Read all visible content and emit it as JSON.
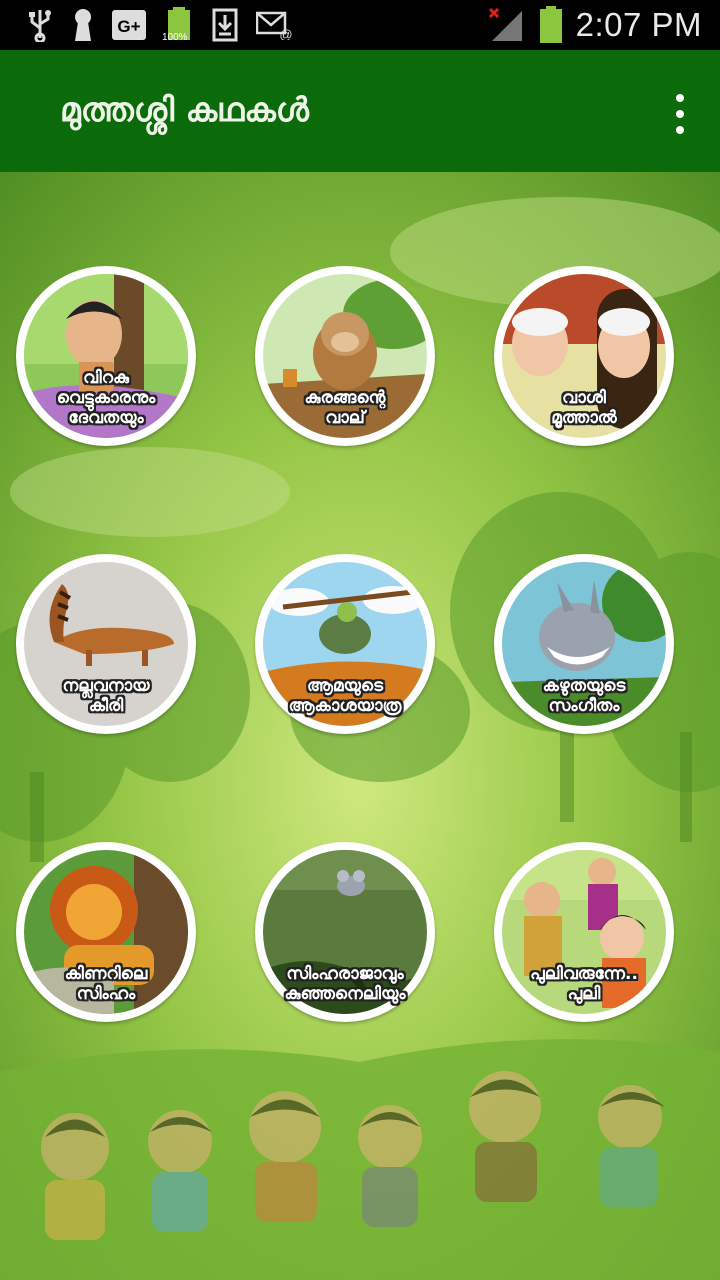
{
  "status_bar": {
    "time": "2:07 PM",
    "battery_text": "100%",
    "icons": [
      "usb-icon",
      "keyhole-icon",
      "google-plus-icon",
      "battery-icon",
      "download-icon",
      "email-icon",
      "signal-icon",
      "battery-icon"
    ]
  },
  "app": {
    "title": "മുത്തശ്ശി കഥകൾ",
    "overflow_menu": "more-vert-icon"
  },
  "colors": {
    "status_bar": "#000000",
    "action_bar": "#0b6b0a",
    "background": "#6aa82c",
    "circle_border": "#ffffff"
  },
  "stories": [
    {
      "line1": "വിറകു",
      "line2": "വെട്ടുകാരനും",
      "line3": "ദേവതയും"
    },
    {
      "line1": "കുരങ്ങന്റെ",
      "line2": "വാല്",
      "line3": ""
    },
    {
      "line1": "വാശി",
      "line2": "മൂത്താൽ",
      "line3": ""
    },
    {
      "line1": "നല്ലവനായ",
      "line2": "കീരി",
      "line3": ""
    },
    {
      "line1": "ആമയുടെ",
      "line2": "ആകാശയാത്ര",
      "line3": ""
    },
    {
      "line1": "കഴുതയുടെ",
      "line2": "സംഗീതം",
      "line3": ""
    },
    {
      "line1": "കിണറിലെ",
      "line2": "സിംഹം",
      "line3": ""
    },
    {
      "line1": "സിംഹരാജാവും",
      "line2": "കുഞ്ഞനെലിയും",
      "line3": ""
    },
    {
      "line1": "പുലിവരുന്നേ..",
      "line2": "പുലി",
      "line3": ""
    }
  ]
}
